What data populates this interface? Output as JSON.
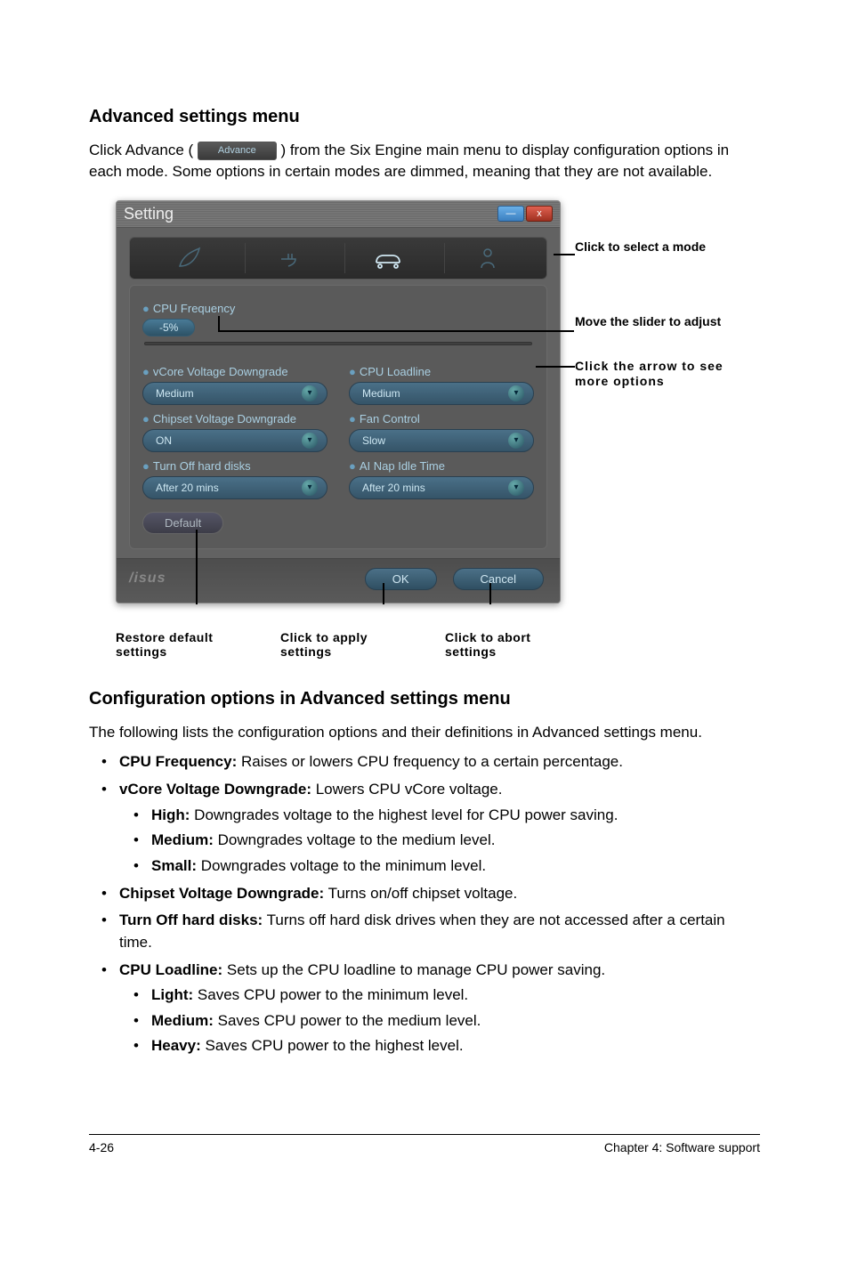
{
  "heading1": "Advanced settings menu",
  "intro_before": "Click Advance (",
  "inline_button_label": "Advance",
  "intro_after": ") from the Six Engine main menu to display configuration options in each mode. Some options in certain modes are dimmed, meaning that they are not available.",
  "window": {
    "title": "Setting",
    "win_min": "—",
    "win_close": "x",
    "sections": {
      "cpu_freq": {
        "label": "CPU Frequency",
        "slider_value": "-5%"
      },
      "vcore": {
        "label": "vCore Voltage Downgrade",
        "value": "Medium"
      },
      "loadline": {
        "label": "CPU Loadline",
        "value": "Medium"
      },
      "chipset": {
        "label": "Chipset Voltage Downgrade",
        "value": "ON"
      },
      "fan": {
        "label": "Fan Control",
        "value": "Slow"
      },
      "turnoff": {
        "label": "Turn Off hard disks",
        "value": "After 20 mins"
      },
      "ainap": {
        "label": "AI Nap Idle Time",
        "value": "After 20 mins"
      }
    },
    "default_btn": "Default",
    "ok_btn": "OK",
    "cancel_btn": "Cancel",
    "logo": "/isus"
  },
  "right_annotations": {
    "a1": "Click to select a mode",
    "a2": "Move the slider to adjust",
    "a3": "Click the arrow to see more options"
  },
  "bottom_annotations": {
    "b1": "Restore default settings",
    "b2": "Click to apply settings",
    "b3": "Click to abort settings"
  },
  "heading2": "Configuration options in Advanced settings menu",
  "config_desc": "The following lists the configuration options and their definitions in Advanced settings menu.",
  "opts": {
    "cpu_freq": {
      "name": "CPU Frequency:",
      "desc": " Raises or lowers CPU frequency to a certain percentage."
    },
    "vcore": {
      "name": "vCore Voltage Downgrade:",
      "desc": " Lowers CPU vCore voltage.",
      "sub": {
        "high": {
          "name": "High:",
          "desc": " Downgrades voltage to the highest level for CPU power saving."
        },
        "medium": {
          "name": "Medium:",
          "desc": " Downgrades voltage to the medium level."
        },
        "small": {
          "name": "Small:",
          "desc": " Downgrades voltage to the minimum level."
        }
      }
    },
    "chipset": {
      "name": "Chipset Voltage Downgrade:",
      "desc": " Turns on/off chipset voltage."
    },
    "turnoff": {
      "name": "Turn Off hard disks:",
      "desc": " Turns off hard disk drives when they are not accessed after a certain time."
    },
    "loadline": {
      "name": "CPU Loadline:",
      "desc": " Sets up the CPU loadline to manage CPU power saving.",
      "sub": {
        "light": {
          "name": "Light:",
          "desc": " Saves CPU power to the minimum level."
        },
        "medium": {
          "name": "Medium:",
          "desc": " Saves CPU power to the medium level."
        },
        "heavy": {
          "name": "Heavy:",
          "desc": " Saves CPU power to the highest level."
        }
      }
    }
  },
  "footer": {
    "left": "4-26",
    "right": "Chapter 4: Software support"
  }
}
